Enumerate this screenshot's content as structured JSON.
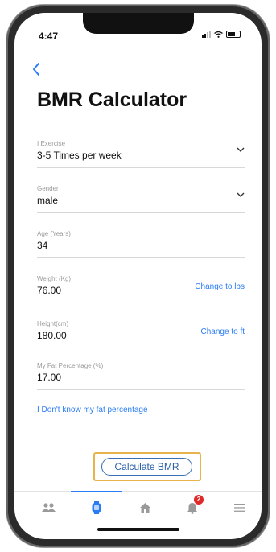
{
  "status": {
    "time": "4:47"
  },
  "nav": {
    "back_icon": "chevron-left-icon"
  },
  "page": {
    "title": "BMR Calculator"
  },
  "form": {
    "exercise": {
      "label": "I Exercise",
      "value": "3-5 Times per week"
    },
    "gender": {
      "label": "Gender",
      "value": "male"
    },
    "age": {
      "label": "Age (Years)",
      "value": "34"
    },
    "weight": {
      "label": "Weight (Kg)",
      "value": "76.00",
      "toggle": "Change to lbs"
    },
    "height": {
      "label": "Height(cm)",
      "value": "180.00",
      "toggle": "Change to ft"
    },
    "fat": {
      "label": "My Fat Percentage (%)",
      "value": "17.00"
    },
    "unknown_fat_link": "I Don't know my fat percentage"
  },
  "actions": {
    "calculate_label": "Calculate BMR"
  },
  "tabbar": {
    "items": [
      {
        "icon": "people-icon"
      },
      {
        "icon": "watch-icon",
        "active": true
      },
      {
        "icon": "home-icon"
      },
      {
        "icon": "bell-icon",
        "badge": "2"
      },
      {
        "icon": "menu-icon"
      }
    ]
  },
  "colors": {
    "accent": "#2a7cf6",
    "highlight_border": "#e8b34a",
    "badge": "#e02a2a"
  }
}
